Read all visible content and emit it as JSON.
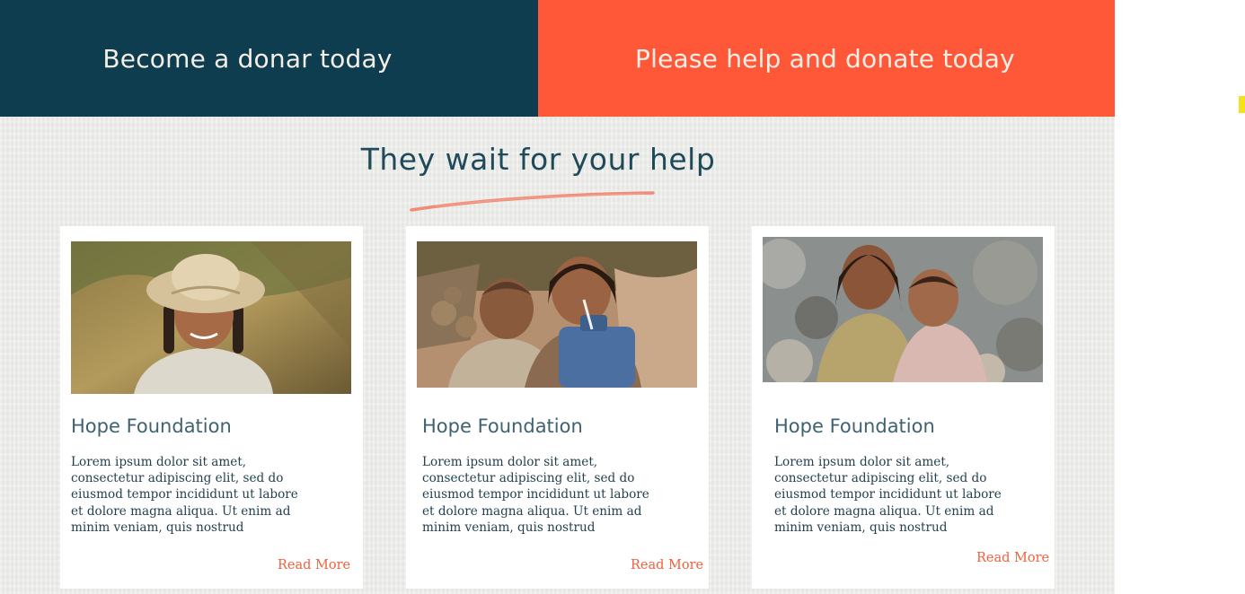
{
  "banners": {
    "left_label": "Become a donar today",
    "right_label": "Please help and donate today"
  },
  "section": {
    "title": "They wait for your help"
  },
  "cards": [
    {
      "title": "Hope Foundation",
      "text": "Lorem ipsum dolor sit amet, consectetur adipiscing elit, sed do eiusmod tempor incididunt ut labore et dolore magna aliqua. Ut enim ad minim veniam, quis nostrud",
      "link": "Read More"
    },
    {
      "title": "Hope Foundation",
      "text": "Lorem ipsum dolor sit amet, consectetur adipiscing elit, sed do eiusmod tempor incididunt ut labore et dolore magna aliqua. Ut enim ad minim veniam, quis nostrud",
      "link": "Read More"
    },
    {
      "title": "Hope Foundation",
      "text": "Lorem ipsum dolor sit amet, consectetur adipiscing elit, sed do eiusmod tempor incididunt ut labore et dolore magna aliqua. Ut enim ad minim veniam, quis nostrud",
      "link": "Read More"
    }
  ],
  "colors": {
    "navy": "#0e3d4f",
    "coral": "#ff5839",
    "link": "#f0613e",
    "background": "#ededea",
    "scrollbar_marker": "#f4e21b"
  }
}
